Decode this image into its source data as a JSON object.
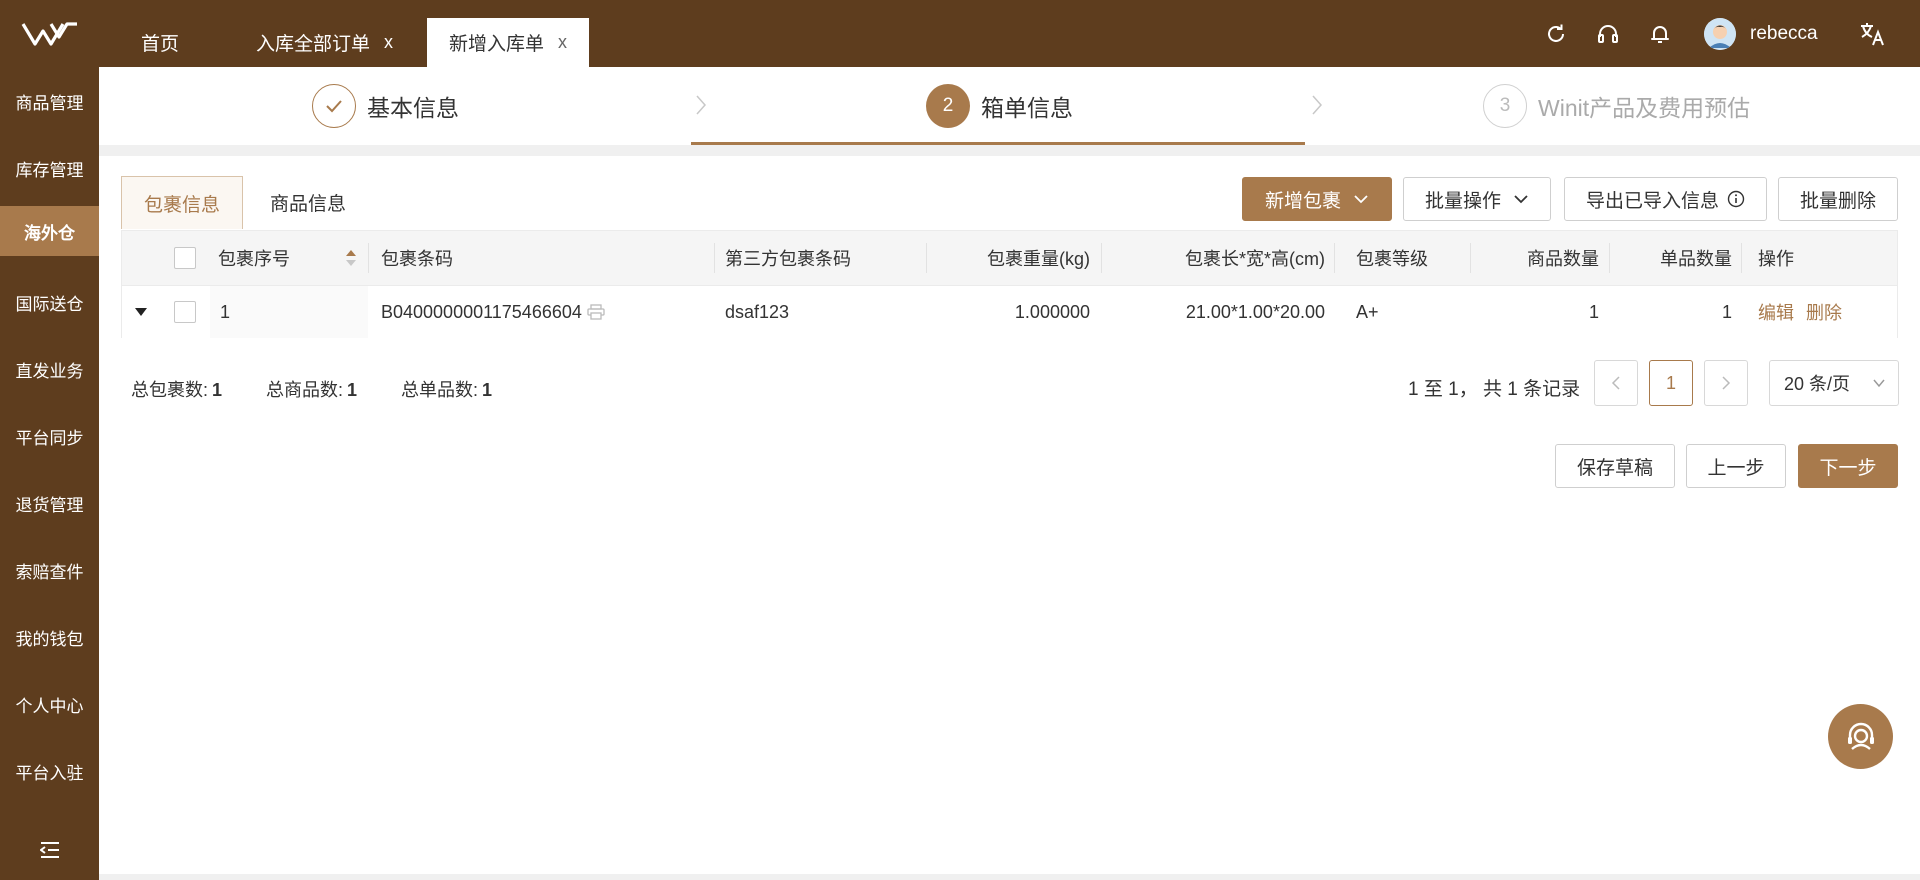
{
  "colors": {
    "brand_dark": "#5e3d1e",
    "accent": "#a87a4c",
    "link": "#a87a4c"
  },
  "sidebar": {
    "logo_icon": "w-logo-icon",
    "items": [
      {
        "label": "商品管理"
      },
      {
        "label": "库存管理"
      },
      {
        "label": "海外仓",
        "active": true
      },
      {
        "label": "国际送仓"
      },
      {
        "label": "直发业务"
      },
      {
        "label": "平台同步"
      },
      {
        "label": "退货管理"
      },
      {
        "label": "索赔查件"
      },
      {
        "label": "我的钱包"
      },
      {
        "label": "个人中心"
      },
      {
        "label": "平台入驻"
      }
    ],
    "collapse_icon": "menu-collapse-icon"
  },
  "topbar": {
    "tabs": [
      {
        "label": "首页",
        "closable": false
      },
      {
        "label": "入库全部订单",
        "close": "x"
      },
      {
        "label": "新增入库单",
        "close": "x",
        "active": true
      }
    ],
    "icons": [
      "refresh-icon",
      "headset-icon",
      "bell-icon",
      "translate-icon"
    ],
    "username": "rebecca"
  },
  "steps": [
    {
      "label": "基本信息",
      "status": "done"
    },
    {
      "number": "2",
      "label": "箱单信息",
      "status": "current"
    },
    {
      "number": "3",
      "label": "Winit产品及费用预估",
      "status": "pending"
    }
  ],
  "subtabs": [
    "包裹信息",
    "商品信息"
  ],
  "toolbar": {
    "add_package": "新增包裹",
    "batch_ops": "批量操作",
    "export_imported": "导出已导入信息",
    "batch_delete": "批量删除"
  },
  "table": {
    "headers": [
      "包裹序号",
      "包裹条码",
      "第三方包裹条码",
      "包裹重量(kg)",
      "包裹长*宽*高(cm)",
      "包裹等级",
      "商品数量",
      "单品数量",
      "操作"
    ],
    "rows": [
      {
        "seq": "1",
        "barcode": "B0400000001175466604",
        "third_party_barcode": "dsaf123",
        "weight": "1.000000",
        "dimensions": "21.00*1.00*20.00",
        "grade": "A+",
        "goods_qty": "1",
        "item_qty": "1",
        "actions": [
          "编辑",
          "删除"
        ]
      }
    ]
  },
  "summary": {
    "total_packages_label": "总包裹数:",
    "total_packages": "1",
    "total_goods_label": "总商品数:",
    "total_goods": "1",
    "total_items_label": "总单品数:",
    "total_items": "1"
  },
  "pagination": {
    "range_text": "1 至 1， 共 1 条记录",
    "current_page": "1",
    "page_size": "20 条/页"
  },
  "footer_buttons": {
    "save_draft": "保存草稿",
    "prev": "上一步",
    "next": "下一步"
  }
}
